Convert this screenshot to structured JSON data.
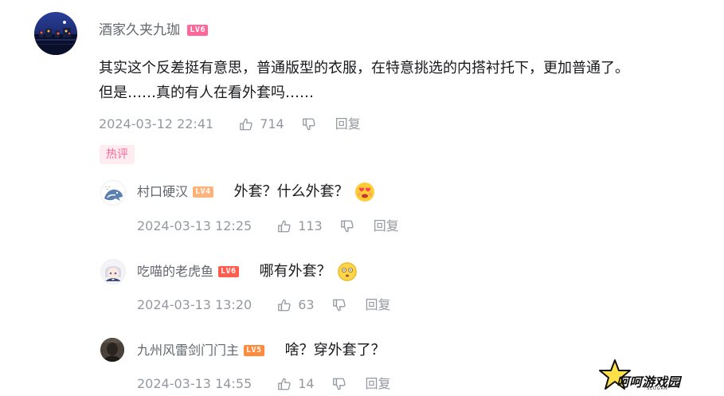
{
  "main_comment": {
    "username": "酒家久夹九珈",
    "level": "LV6",
    "level_color": "#ff6699",
    "text_line1": "其实这个反差挺有意思，普通版型的衣服，在特意挑选的内搭衬托下，更加普通了。",
    "text_line2": "但是……真的有人在看外套吗……",
    "time": "2024-03-12 22:41",
    "likes": "714",
    "reply_label": "回复",
    "tag": "热评"
  },
  "replies": [
    {
      "username": "村口硬汉",
      "level": "LV4",
      "level_color": "#ffb37c",
      "text": "外套？什么外套？",
      "emoji": "heart-eyes-emoji",
      "time": "2024-03-13 12:25",
      "likes": "113",
      "reply_label": "回复"
    },
    {
      "username": "吃喵的老虎鱼",
      "level": "LV6",
      "level_color": "#ff5c4d",
      "text": "哪有外套？",
      "emoji": "dazed-emoji",
      "time": "2024-03-13 13:20",
      "likes": "63",
      "reply_label": "回复"
    },
    {
      "username": "九州风雷剑门门主",
      "level": "LV5",
      "level_color": "#ff8a3c",
      "text": "啥？穿外套了？",
      "time": "2024-03-13 14:55",
      "likes": "14",
      "reply_label": "回复"
    }
  ],
  "watermark": {
    "name": "呵呵游戏园",
    "sub": "SLOGAN"
  }
}
